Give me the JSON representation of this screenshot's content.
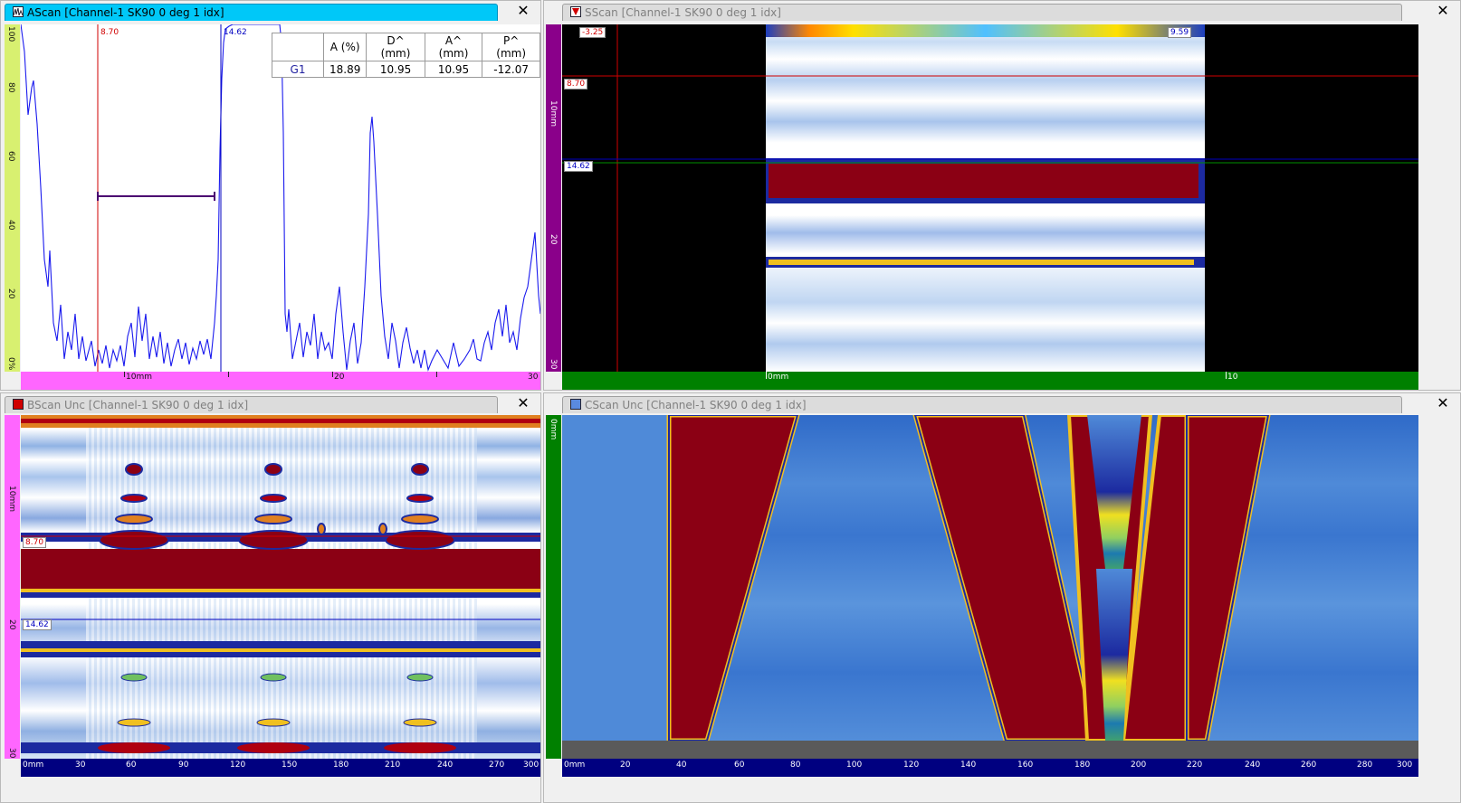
{
  "ascan": {
    "title": "AScan [Channel-1 SK90 0 deg 1 idx]",
    "close": "✕",
    "cursor_red": "8.70",
    "cursor_blue": "14.62",
    "gate_table": {
      "headers": [
        "",
        "A (%)",
        "D^ (mm)",
        "A^ (mm)",
        "P^ (mm)"
      ],
      "row": [
        "G1",
        "18.89",
        "10.95",
        "10.95",
        "-12.07"
      ]
    },
    "yruler": [
      "100",
      "80",
      "60",
      "40",
      "20",
      "0%"
    ],
    "xruler": [
      "10mm",
      "20",
      "30"
    ]
  },
  "sscan": {
    "title": "SScan [Channel-1 SK90 0 deg 1 idx]",
    "close": "✕",
    "marker_top_left": "-3.25",
    "marker_top_right": "9.59",
    "cursor_red": "8.70",
    "cursor_blue": "14.62",
    "yruler": [
      "10mm",
      "20",
      "30"
    ],
    "xruler": [
      "0mm",
      "10"
    ]
  },
  "bscan": {
    "title": "BScan Unc [Channel-1 SK90 0 deg 1 idx]",
    "close": "✕",
    "cursor_red": "8.70",
    "cursor_blue": "14.62",
    "yruler": [
      "10mm",
      "20",
      "30"
    ],
    "xruler": [
      "0mm",
      "30",
      "60",
      "90",
      "120",
      "150",
      "180",
      "210",
      "240",
      "270",
      "300"
    ]
  },
  "cscan": {
    "title": "CScan Unc [Channel-1 SK90 0 deg 1 idx]",
    "close": "✕",
    "yruler": [
      "0mm"
    ],
    "xruler": [
      "0mm",
      "20",
      "40",
      "60",
      "80",
      "100",
      "120",
      "140",
      "160",
      "180",
      "200",
      "220",
      "240",
      "260",
      "280",
      "300"
    ]
  },
  "colors": {
    "active_tab": "#00c8f8",
    "ascan_yruler": "#d8f070",
    "ascan_xruler": "#ff66ff",
    "sscan_yruler": "#8a008a",
    "sscan_xruler": "#008000",
    "bscan_yruler": "#ff66ff",
    "bscan_xruler": "#000080",
    "cscan_yruler": "#008000",
    "cscan_xruler": "#000080",
    "red_cursor": "#d00000",
    "blue_cursor": "#0000c0"
  }
}
